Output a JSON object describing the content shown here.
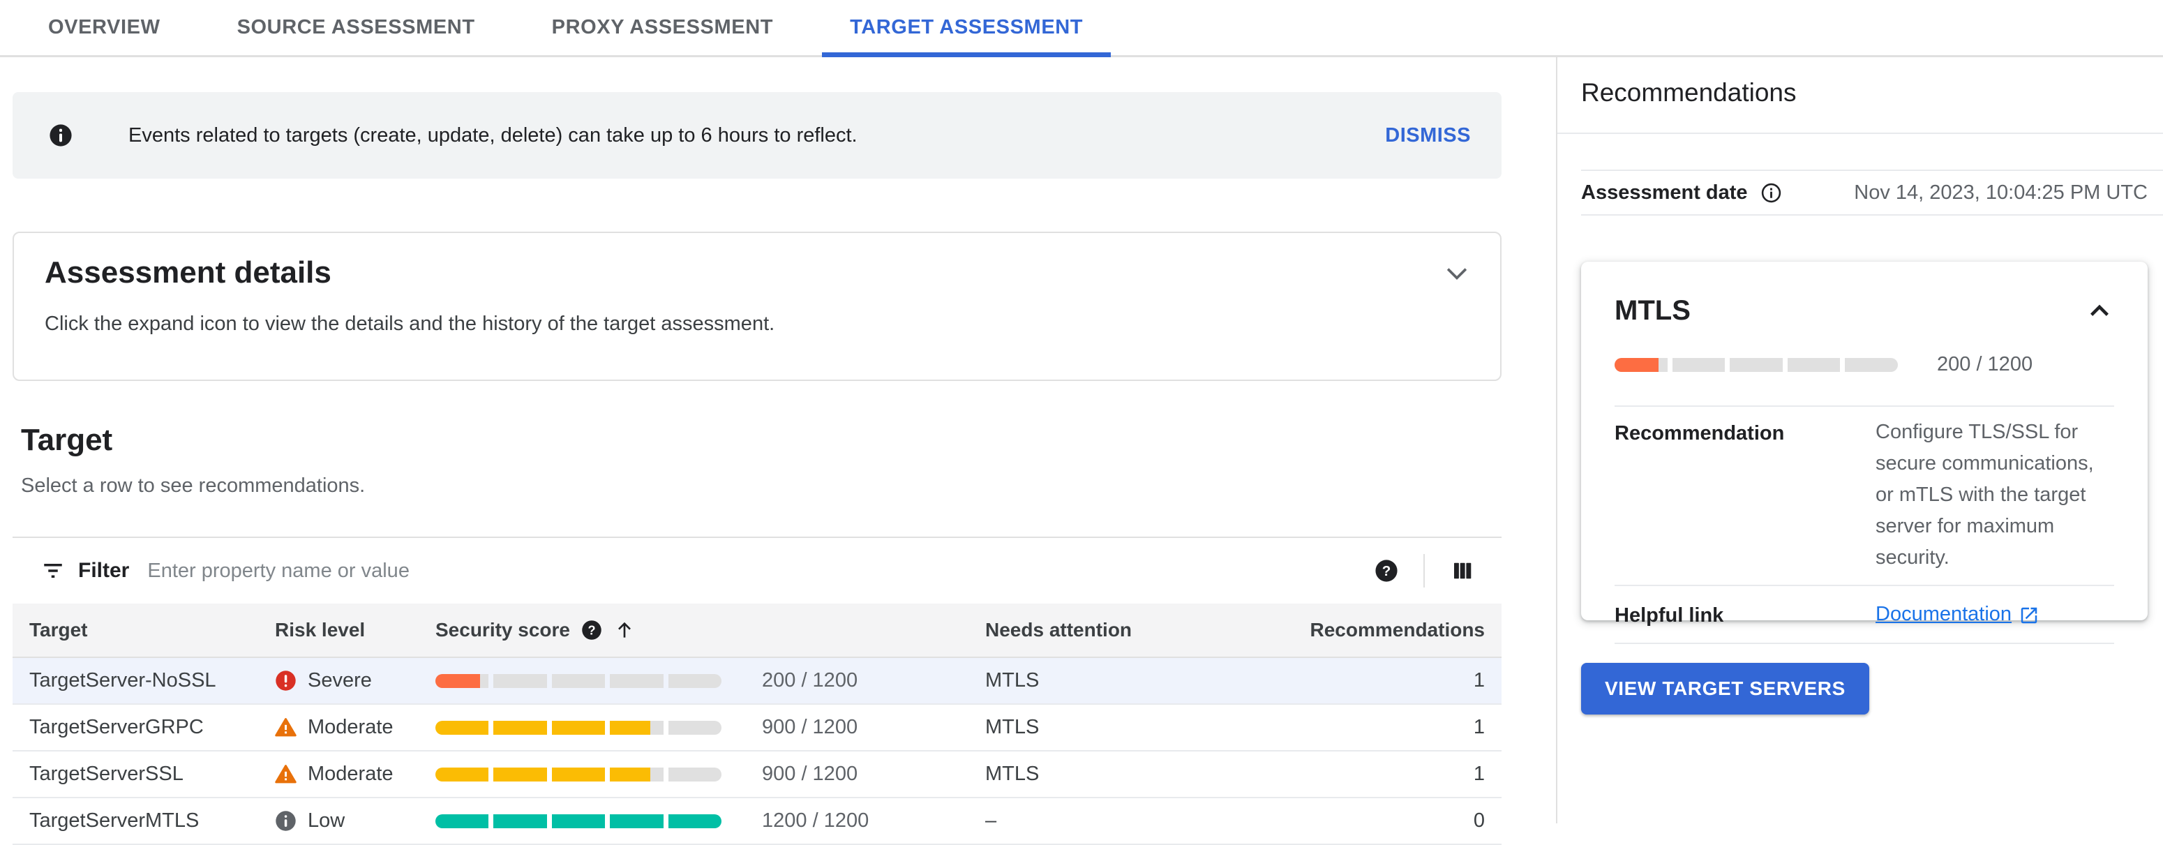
{
  "tabs": [
    {
      "label": "OVERVIEW",
      "active": false
    },
    {
      "label": "SOURCE ASSESSMENT",
      "active": false
    },
    {
      "label": "PROXY ASSESSMENT",
      "active": false
    },
    {
      "label": "TARGET ASSESSMENT",
      "active": true
    }
  ],
  "banner": {
    "icon": "info-icon",
    "text": "Events related to targets (create, update, delete) can take up to 6 hours to reflect.",
    "dismiss_label": "DISMISS"
  },
  "assessment_details": {
    "title": "Assessment details",
    "description": "Click the expand icon to view the details and the history of the target assessment."
  },
  "target_section": {
    "title": "Target",
    "subtitle": "Select a row to see recommendations."
  },
  "filter": {
    "label": "Filter",
    "placeholder": "Enter property name or value"
  },
  "table": {
    "columns": {
      "target": "Target",
      "risk": "Risk level",
      "score": "Security score",
      "attention": "Needs attention",
      "recommendations": "Recommendations"
    },
    "score_max": 1200,
    "rows": [
      {
        "target": "TargetServer-NoSSL",
        "risk": "Severe",
        "risk_level": "severe",
        "score": 200,
        "score_text": "200 / 1200",
        "attention": "MTLS",
        "recommendations": "1",
        "selected": true
      },
      {
        "target": "TargetServerGRPC",
        "risk": "Moderate",
        "risk_level": "moderate",
        "score": 900,
        "score_text": "900 / 1200",
        "attention": "MTLS",
        "recommendations": "1",
        "selected": false
      },
      {
        "target": "TargetServerSSL",
        "risk": "Moderate",
        "risk_level": "moderate",
        "score": 900,
        "score_text": "900 / 1200",
        "attention": "MTLS",
        "recommendations": "1",
        "selected": false
      },
      {
        "target": "TargetServerMTLS",
        "risk": "Low",
        "risk_level": "low",
        "score": 1200,
        "score_text": "1200 / 1200",
        "attention": "–",
        "recommendations": "0",
        "selected": false
      }
    ]
  },
  "panel": {
    "title": "Recommendations",
    "assessment_date_label": "Assessment date",
    "assessment_date_value": "Nov 14, 2023, 10:04:25 PM UTC",
    "card": {
      "title": "MTLS",
      "level": "severe",
      "score": 200,
      "score_max": 1200,
      "score_text": "200 / 1200",
      "recommendation_label": "Recommendation",
      "recommendation_text": "Configure TLS/SSL for secure communications, or mTLS with the target server for maximum security.",
      "helpful_link_label": "Helpful link",
      "link_text": "Documentation",
      "link_icon": "external-link-icon"
    },
    "button_label": "VIEW TARGET SERVERS"
  },
  "colors": {
    "accent": "#3367d6",
    "link": "#1a73e8",
    "severe": "#d93025",
    "moderate": "#e8710a",
    "low": "#5f6368",
    "bar_severe": "#fd6d42",
    "bar_moderate": "#fbbc04",
    "bar_good": "#00bfa5",
    "track": "#e0e0e0"
  }
}
